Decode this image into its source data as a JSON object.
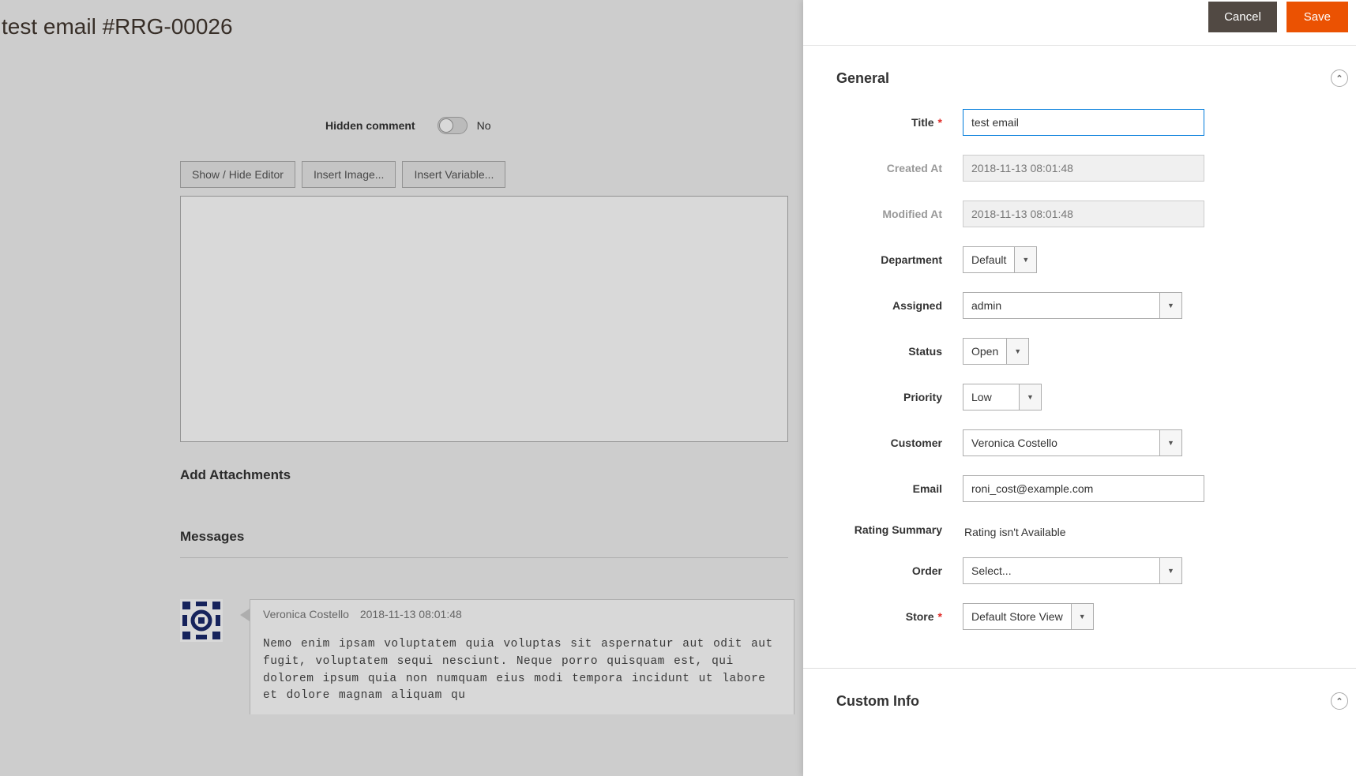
{
  "page": {
    "title": "test email #RRG-00026"
  },
  "editor": {
    "hidden_comment_label": "Hidden comment",
    "hidden_comment_value": "No",
    "toolbar": {
      "show_hide": "Show / Hide Editor",
      "insert_image": "Insert Image...",
      "insert_variable": "Insert Variable..."
    },
    "add_attachments_label": "Add Attachments",
    "messages_label": "Messages"
  },
  "message": {
    "author": "Veronica Costello",
    "date": "2018-11-13 08:01:48",
    "text": "Nemo enim ipsam voluptatem quia voluptas sit aspernatur aut odit aut fugit, voluptatem sequi nesciunt. Neque porro quisquam est, qui dolorem ipsum quia non numquam eius modi tempora incidunt ut labore et dolore magnam aliquam qu"
  },
  "panel": {
    "actions": {
      "cancel": "Cancel",
      "save": "Save"
    },
    "sections": {
      "general": "General",
      "custom_info": "Custom Info"
    },
    "labels": {
      "title": "Title",
      "created_at": "Created At",
      "modified_at": "Modified At",
      "department": "Department",
      "assigned": "Assigned",
      "status": "Status",
      "priority": "Priority",
      "customer": "Customer",
      "email": "Email",
      "rating_summary": "Rating Summary",
      "order": "Order",
      "store": "Store"
    },
    "values": {
      "title": "test email",
      "created_at": "2018-11-13 08:01:48",
      "modified_at": "2018-11-13 08:01:48",
      "department": "Default",
      "assigned": "admin",
      "status": "Open",
      "priority": "Low",
      "customer": "Veronica Costello",
      "email": "roni_cost@example.com",
      "rating_summary": "Rating isn't Available",
      "order": "Select...",
      "store": "Default Store View"
    }
  }
}
